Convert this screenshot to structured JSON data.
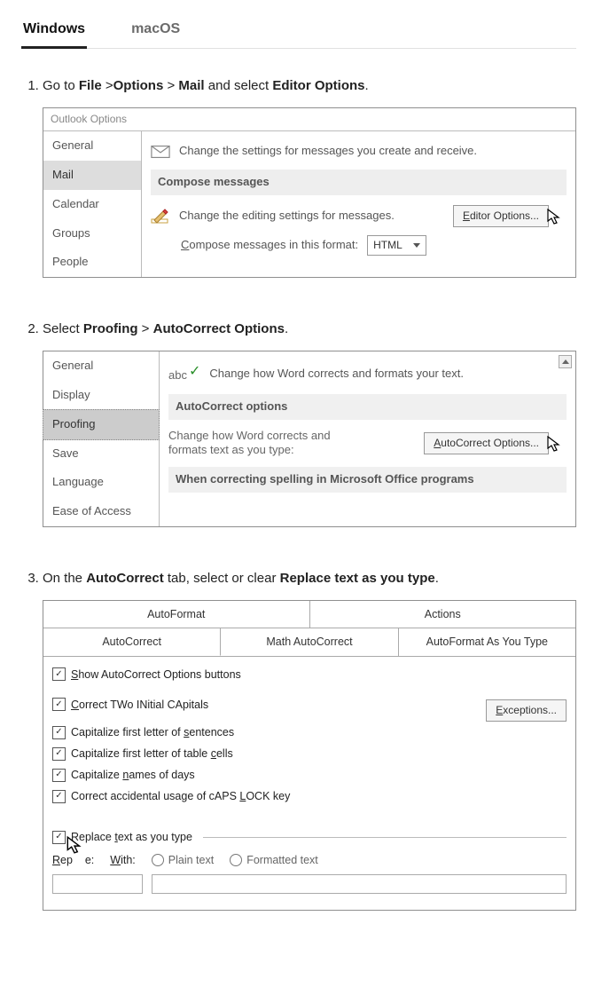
{
  "tabs": {
    "windows": "Windows",
    "macos": "macOS"
  },
  "step1": {
    "text_pre": "Go to ",
    "file": "File",
    "gt1": " >",
    "options": "Options",
    "gt2": " > ",
    "mail": "Mail",
    "mid": " and select ",
    "editor_options": "Editor Options",
    "tail": ".",
    "dialog_title": "Outlook Options",
    "left_items": [
      "General",
      "Mail",
      "Calendar",
      "Groups",
      "People"
    ],
    "desc": "Change the settings for messages you create and receive.",
    "compose_head": "Compose messages",
    "edit_desc": "Change the editing settings for messages.",
    "editor_btn": "Editor Options...",
    "format_label": "Compose messages in this format:",
    "format_value": "HTML"
  },
  "step2": {
    "text_pre": "Select ",
    "proofing": "Proofing",
    "gt": " > ",
    "ac_opt": "AutoCorrect Options",
    "tail": ".",
    "left_items": [
      "General",
      "Display",
      "Proofing",
      "Save",
      "Language",
      "Ease of Access"
    ],
    "abc_label": "abc",
    "desc": "Change how Word corrects and formats your text.",
    "head": "AutoCorrect options",
    "subdesc": "Change how Word corrects and formats text as you type:",
    "btn": "AutoCorrect Options...",
    "foot": "When correcting spelling in Microsoft Office programs"
  },
  "step3": {
    "text_pre": "On the ",
    "ac_tab": "AutoCorrect",
    "mid": " tab, select or clear ",
    "replace": "Replace text as you type",
    "tail": ".",
    "top_tabs": {
      "autoformat": "AutoFormat",
      "actions": "Actions",
      "autocorrect": "AutoCorrect",
      "math": "Math AutoCorrect",
      "as_you": "AutoFormat As You Type"
    },
    "show_opts": "Show AutoCorrect Options buttons",
    "c1": "Correct TWo INitial CApitals",
    "c2": "Capitalize first letter of sentences",
    "c3": "Capitalize first letter of table cells",
    "c4": "Capitalize names of days",
    "c5": "Correct accidental usage of cAPS LOCK key",
    "exceptions": "Exceptions...",
    "replace_ck": "Replace text as you type",
    "replace_lbl": "Replace:",
    "with_lbl": "With:",
    "plain": "Plain text",
    "formatted": "Formatted text"
  }
}
